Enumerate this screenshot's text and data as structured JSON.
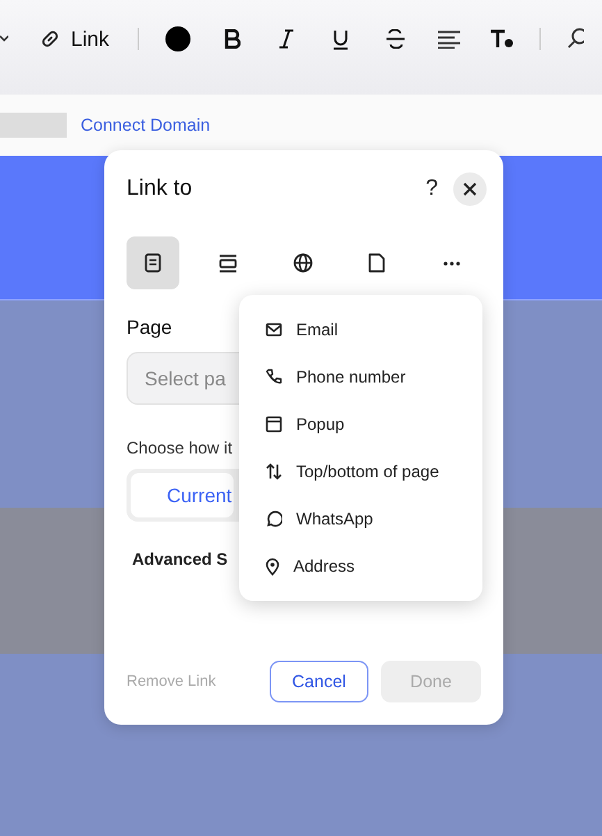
{
  "toolbar": {
    "link_label": "Link"
  },
  "address_bar": {
    "link": "Connect Domain"
  },
  "dialog": {
    "title": "Link to",
    "help": "?",
    "tabs": [
      {
        "kind": "page",
        "selected": true
      },
      {
        "kind": "section",
        "selected": false
      },
      {
        "kind": "web",
        "selected": false
      },
      {
        "kind": "document",
        "selected": false
      },
      {
        "kind": "more",
        "selected": false
      }
    ],
    "page_label": "Page",
    "page_field": {
      "placeholder": "Select pa"
    },
    "open_label": "Choose how it",
    "open_option": "Current",
    "advanced": "Advanced S",
    "remove_link": {
      "label": "Remove Link",
      "disabled": true
    },
    "cancel": "Cancel",
    "done": {
      "label": "Done",
      "disabled": true
    }
  },
  "menu": [
    {
      "kind": "email",
      "label": "Email"
    },
    {
      "kind": "phone",
      "label": "Phone number"
    },
    {
      "kind": "popup",
      "label": "Popup"
    },
    {
      "kind": "anchor",
      "label": "Top/bottom of page"
    },
    {
      "kind": "whatsapp",
      "label": "WhatsApp"
    },
    {
      "kind": "address",
      "label": "Address"
    }
  ]
}
